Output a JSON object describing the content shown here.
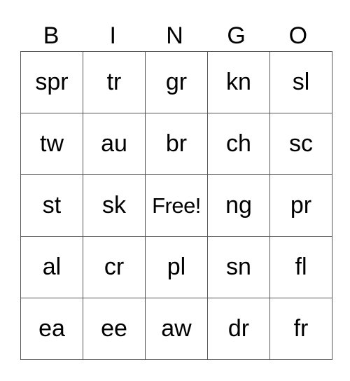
{
  "header": [
    "B",
    "I",
    "N",
    "G",
    "O"
  ],
  "rows": [
    [
      "spr",
      "tr",
      "gr",
      "kn",
      "sl"
    ],
    [
      "tw",
      "au",
      "br",
      "ch",
      "sc"
    ],
    [
      "st",
      "sk",
      "Free!",
      "ng",
      "pr"
    ],
    [
      "al",
      "cr",
      "pl",
      "sn",
      "fl"
    ],
    [
      "ea",
      "ee",
      "aw",
      "dr",
      "fr"
    ]
  ]
}
